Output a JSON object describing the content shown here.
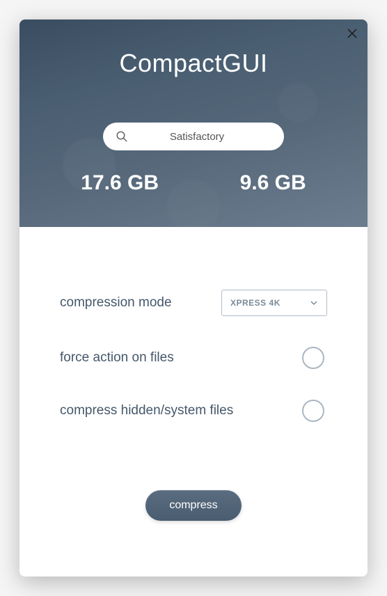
{
  "app": {
    "title": "CompactGUI"
  },
  "search": {
    "value": "Satisfactory"
  },
  "sizes": {
    "before": "17.6 GB",
    "after": "9.6 GB"
  },
  "options": {
    "compression_mode": {
      "label": "compression mode",
      "selected": "XPRESS 4K"
    },
    "force_action": {
      "label": "force action on files",
      "checked": false
    },
    "compress_hidden": {
      "label": "compress hidden/system files",
      "checked": false
    }
  },
  "actions": {
    "compress_label": "compress"
  }
}
